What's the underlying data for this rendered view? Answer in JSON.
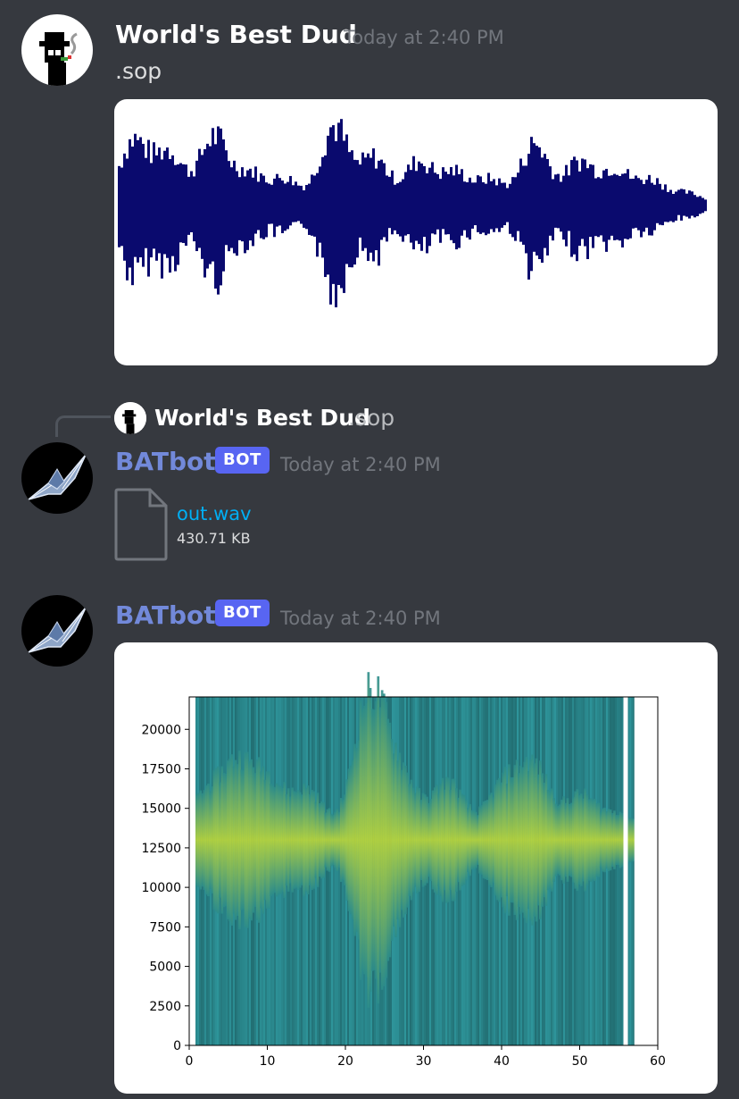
{
  "messages": [
    {
      "author": "World's Best Dud",
      "timestamp": "Today at 2:40 PM",
      "content": ".sop",
      "attachment_type": "waveform-image"
    },
    {
      "reply": {
        "author": "World's Best Dud",
        "content": ".sop"
      },
      "author": "BATbot",
      "badge": "BOT",
      "timestamp": "Today at 2:40 PM",
      "file": {
        "name": "out.wav",
        "size": "430.71 KB"
      }
    },
    {
      "author": "BATbot",
      "badge": "BOT",
      "timestamp": "Today at 2:40 PM",
      "attachment_type": "spectrogram-image"
    }
  ],
  "chart_data": [
    {
      "type": "heatmap",
      "xticks": [
        "0",
        "10",
        "20",
        "30",
        "40",
        "50",
        "60"
      ],
      "yticks": [
        "0",
        "2500",
        "5000",
        "7500",
        "10000",
        "12500",
        "15000",
        "17500",
        "20000"
      ],
      "xlim": [
        0,
        60
      ],
      "ylim": [
        0,
        22050
      ],
      "colormap": "viridis"
    }
  ],
  "colors": {
    "background": "#36393f",
    "bot_name": "#7289da",
    "bot_badge": "#5865f2",
    "link": "#00aff4",
    "waveform": "#0a0a6e"
  }
}
